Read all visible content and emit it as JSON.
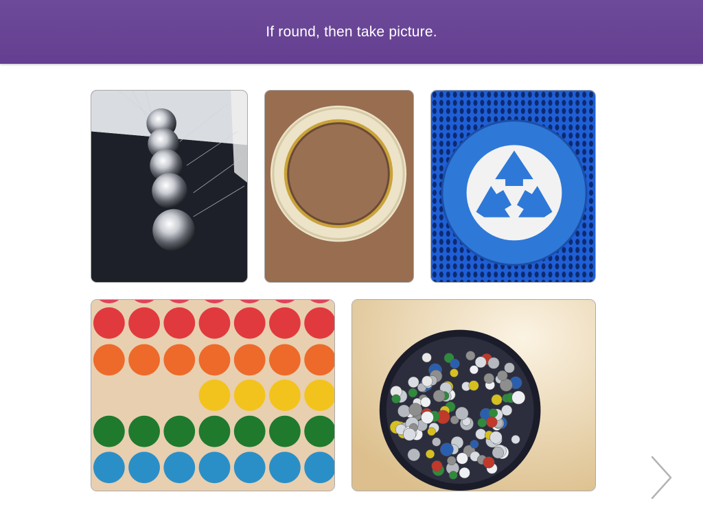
{
  "header": {
    "title": "If round, then take picture."
  },
  "photos": [
    {
      "subject": "newtons-cradle-balls"
    },
    {
      "subject": "roll-of-tape"
    },
    {
      "subject": "recycle-symbol-bin"
    },
    {
      "subject": "colored-dot-stickers"
    },
    {
      "subject": "bowl-of-thumbtacks"
    }
  ],
  "colors": {
    "header_bg": "#6a4596",
    "header_text": "#ffffff",
    "next_arrow": "#b3b3b3"
  },
  "navigation": {
    "next_icon": "chevron-right-icon"
  }
}
